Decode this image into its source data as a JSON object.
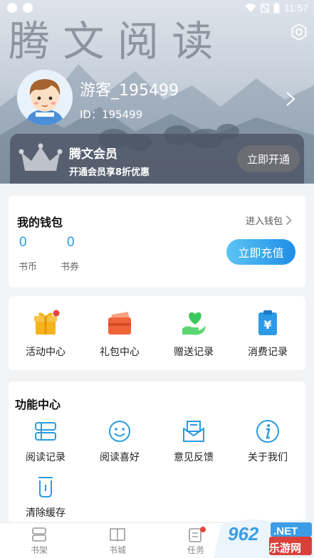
{
  "status_bar": {
    "time": "11:57"
  },
  "header": {
    "username": "游客_195499",
    "user_id": "ID：195499",
    "bg_calligraphy": "腾 文 阅 读"
  },
  "member": {
    "title": "腾文会员",
    "subtitle": "开通会员享8折优惠",
    "button": "立即开通"
  },
  "wallet": {
    "title": "我的钱包",
    "link": "进入钱包",
    "coins_value": "0",
    "coins_label": "书币",
    "vouchers_value": "0",
    "vouchers_label": "书券",
    "recharge_button": "立即充值"
  },
  "quick_actions": [
    {
      "label": "活动中心",
      "icon": "gift-icon"
    },
    {
      "label": "礼包中心",
      "icon": "wallet-card-icon"
    },
    {
      "label": "赠送记录",
      "icon": "heart-hand-icon"
    },
    {
      "label": "消费记录",
      "icon": "receipt-yen-icon"
    }
  ],
  "functions": {
    "title": "功能中心",
    "items": [
      {
        "label": "阅读记录",
        "icon": "reading-record-icon"
      },
      {
        "label": "阅读喜好",
        "icon": "smile-icon"
      },
      {
        "label": "意见反馈",
        "icon": "feedback-mail-icon"
      },
      {
        "label": "关于我们",
        "icon": "info-icon"
      },
      {
        "label": "清除缓存",
        "icon": "trash-icon"
      }
    ]
  },
  "bottom_nav": [
    {
      "label": "书架",
      "icon": "bookshelf-icon"
    },
    {
      "label": "书城",
      "icon": "book-city-icon"
    },
    {
      "label": "任务",
      "icon": "task-icon"
    }
  ],
  "watermark": {
    "text1": "962",
    "text2": ".NET",
    "text3": "乐游网"
  },
  "colors": {
    "accent": "#2a9be0",
    "badge": "#e8453c",
    "gift": "#f5b41d",
    "card": "#f0643a",
    "green": "#3cc85a"
  }
}
